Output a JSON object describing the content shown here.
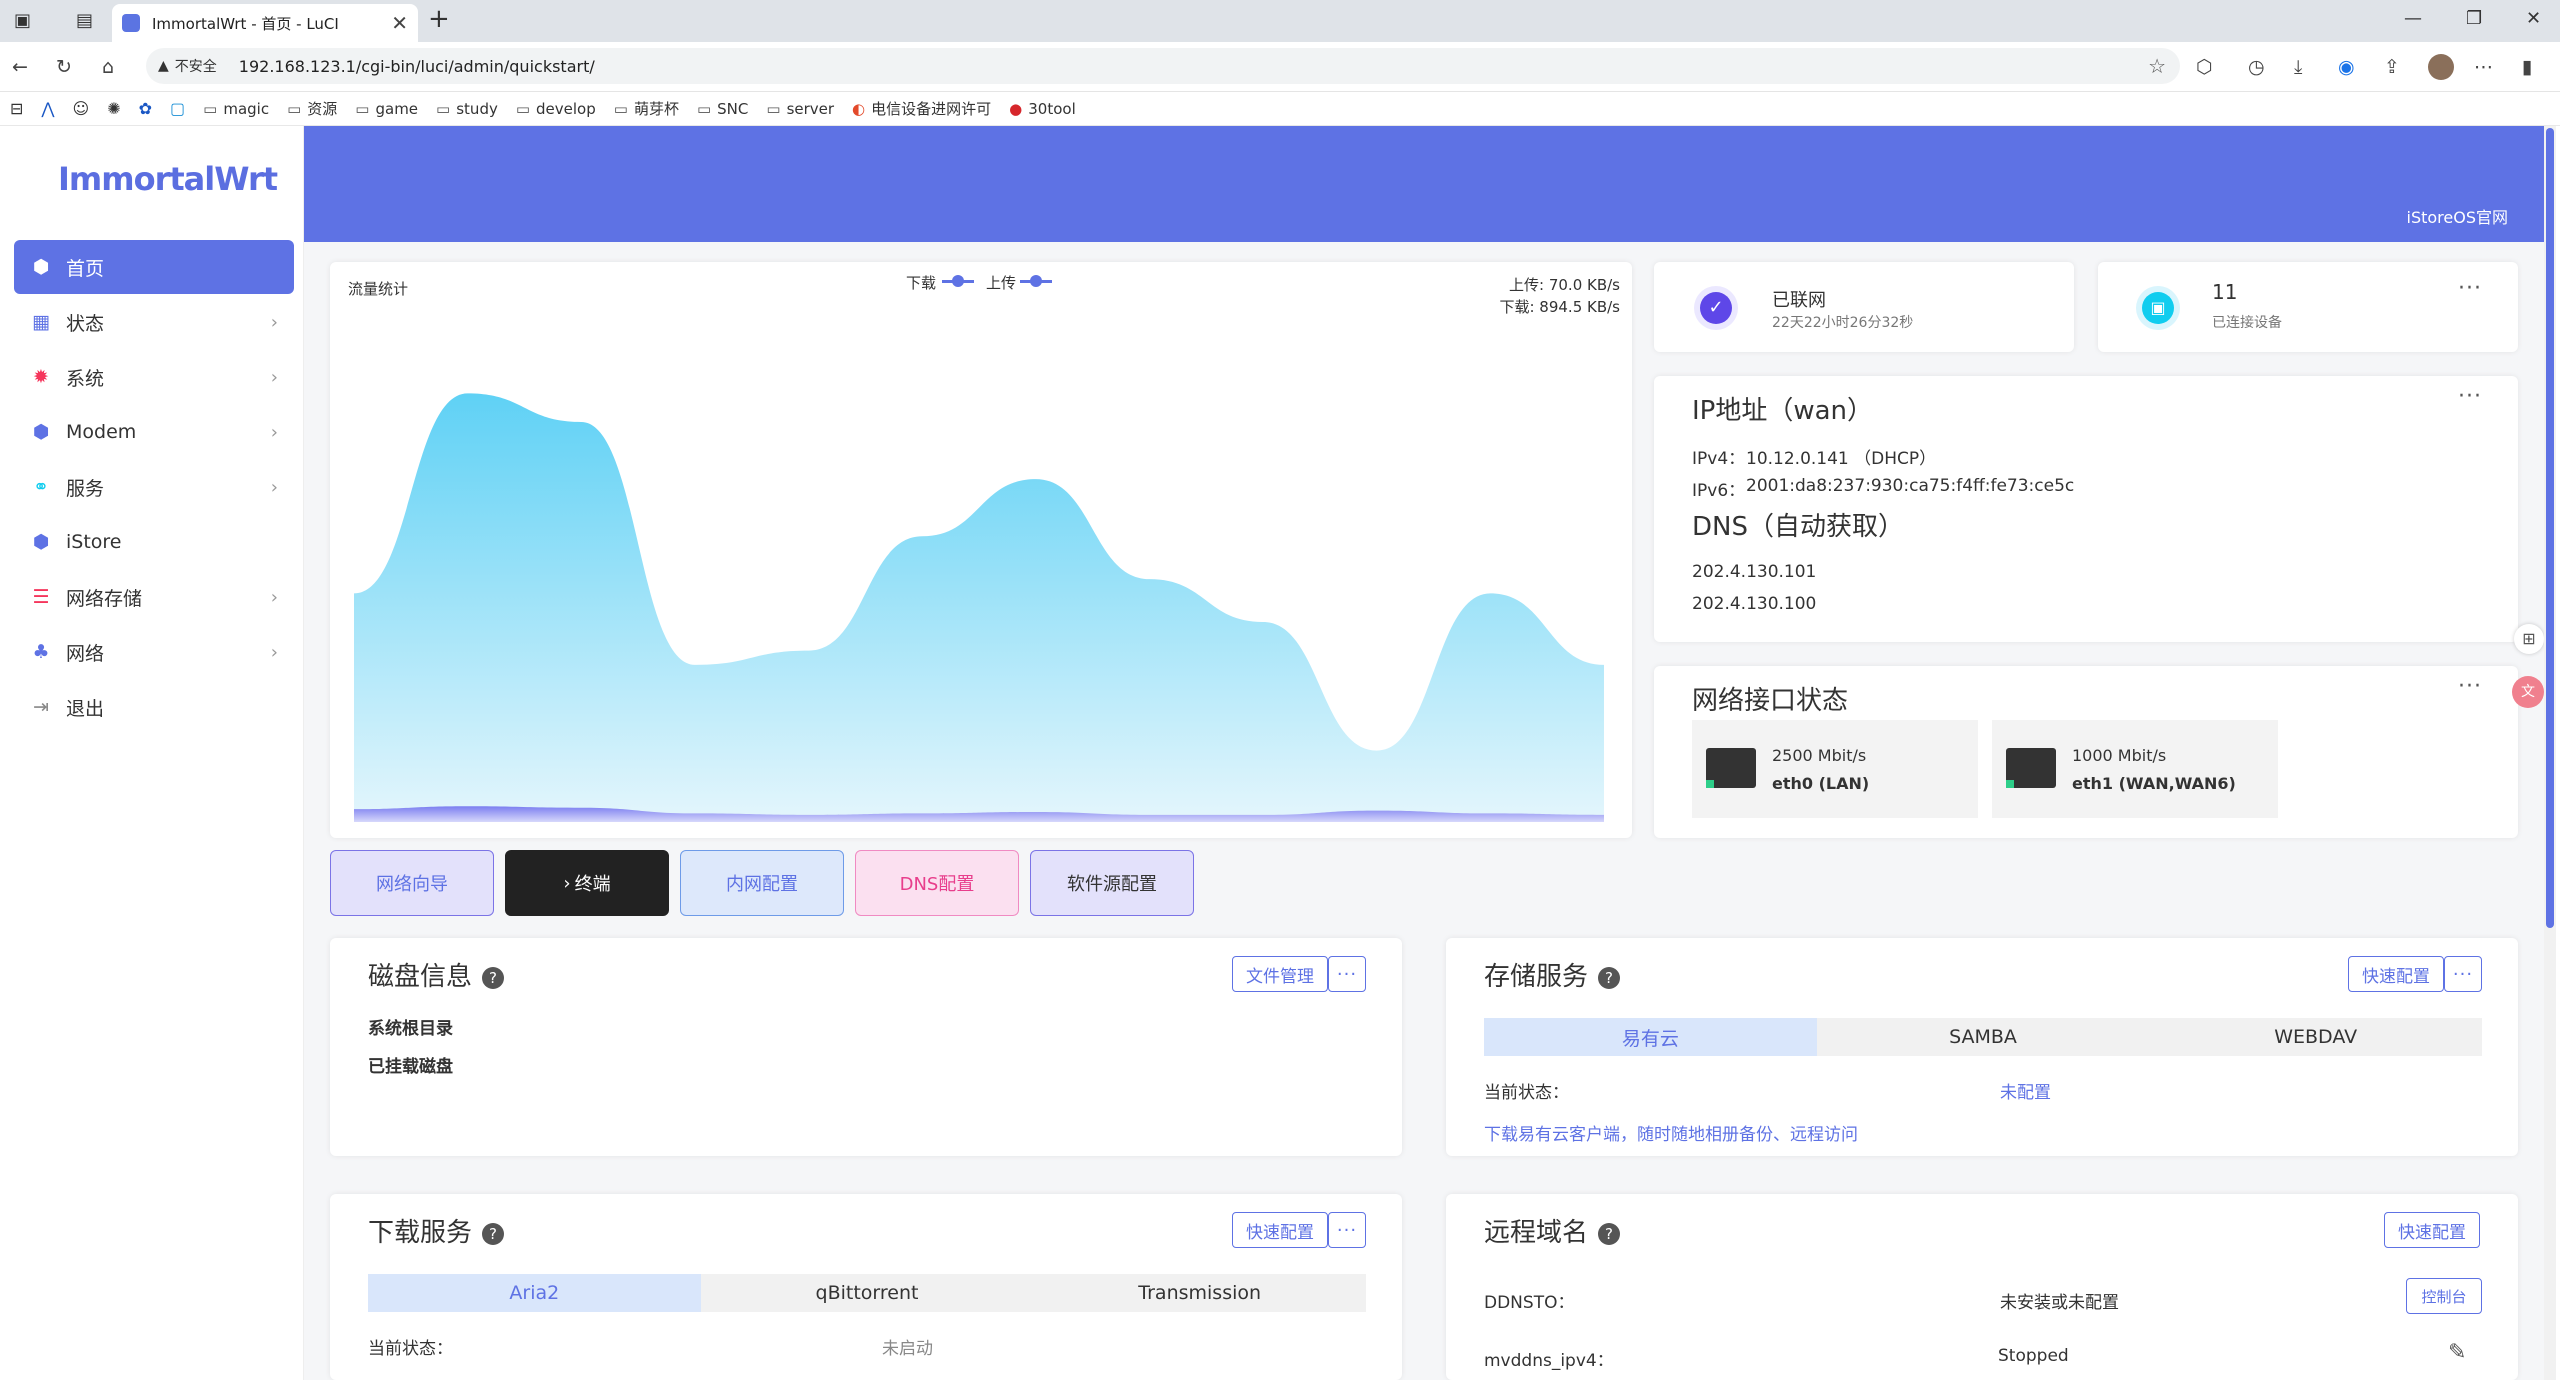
{
  "browser": {
    "tab_title": "ImmortalWrt - 首页 - LuCI",
    "insecure": "不安全",
    "url": "192.168.123.1/cgi-bin/luci/admin/quickstart/",
    "bookmarks": [
      "magic",
      "资源",
      "game",
      "study",
      "develop",
      "萌芽杯",
      "SNC",
      "server",
      "电信设备进网许可",
      "30tool"
    ]
  },
  "app": {
    "logo": "ImmortalWrt",
    "header_link": "iStoreOS官网"
  },
  "sidebar": {
    "items": [
      {
        "label": "首页",
        "icon": "cube-icon",
        "color": "#5e72e4"
      },
      {
        "label": "状态",
        "icon": "dashboard-icon",
        "color": "#5e72e4"
      },
      {
        "label": "系统",
        "icon": "gear-icon",
        "color": "#f5365c"
      },
      {
        "label": "Modem",
        "icon": "cube-icon",
        "color": "#5e72e4"
      },
      {
        "label": "服务",
        "icon": "link-icon",
        "color": "#11cdef"
      },
      {
        "label": "iStore",
        "icon": "cube-icon",
        "color": "#5e72e4"
      },
      {
        "label": "网络存储",
        "icon": "database-icon",
        "color": "#f5365c"
      },
      {
        "label": "网络",
        "icon": "network-icon",
        "color": "#5e72e4"
      },
      {
        "label": "退出",
        "icon": "logout-icon",
        "color": "#888"
      }
    ]
  },
  "traffic": {
    "title": "流量统计",
    "legend_down": "下载",
    "legend_up": "上传",
    "upload": "上传: 70.0 KB/s",
    "download": "下载: 894.5 KB/s"
  },
  "chart_data": {
    "type": "area",
    "title": "流量统计",
    "series": [
      {
        "name": "下载",
        "values": [
          320,
          600,
          560,
          220,
          240,
          400,
          480,
          340,
          280,
          100,
          320,
          220
        ]
      },
      {
        "name": "上传",
        "values": [
          18,
          22,
          20,
          12,
          10,
          12,
          14,
          10,
          10,
          16,
          12,
          10
        ]
      }
    ]
  },
  "status": {
    "network": "已联网",
    "uptime": "22天22小时26分32秒",
    "devices_count": "11",
    "devices_label": "已连接设备"
  },
  "ip": {
    "title": "IP地址（wan）",
    "ipv4_label": "IPv4：",
    "ipv4": "10.12.0.141 （DHCP）",
    "ipv6_label": "IPv6：",
    "ipv6": "2001:da8:237:930:ca75:f4ff:fe73:ce5c",
    "dns_title": "DNS（自动获取）",
    "dns1": "202.4.130.101",
    "dns2": "202.4.130.100"
  },
  "iface": {
    "title": "网络接口状态",
    "ports": [
      {
        "speed": "2500 Mbit/s",
        "name": "eth0 (LAN)"
      },
      {
        "speed": "1000 Mbit/s",
        "name": "eth1 (WAN,WAN6)"
      }
    ]
  },
  "quick": [
    "网络向导",
    "终端",
    "内网配置",
    "DNS配置",
    "软件源配置"
  ],
  "disk": {
    "title": "磁盘信息",
    "btn": "文件管理",
    "root": "系统根目录",
    "mounted": "已挂载磁盘"
  },
  "storage": {
    "title": "存储服务",
    "btn": "快速配置",
    "tabs": [
      "易有云",
      "SAMBA",
      "WEBDAV"
    ],
    "state_label": "当前状态：",
    "state": "未配置",
    "link": "下载易有云客户端，随时随地相册备份、远程访问"
  },
  "download": {
    "title": "下载服务",
    "btn": "快速配置",
    "tabs": [
      "Aria2",
      "qBittorrent",
      "Transmission"
    ],
    "state_label": "当前状态：",
    "state": "未启动"
  },
  "remote": {
    "title": "远程域名",
    "btn": "快速配置",
    "ddnsto_label": "DDNSTO：",
    "ddnsto": "未安装或未配置",
    "console": "控制台",
    "mvddns_label": "mvddns_ipv4：",
    "mvddns": "Stopped"
  }
}
